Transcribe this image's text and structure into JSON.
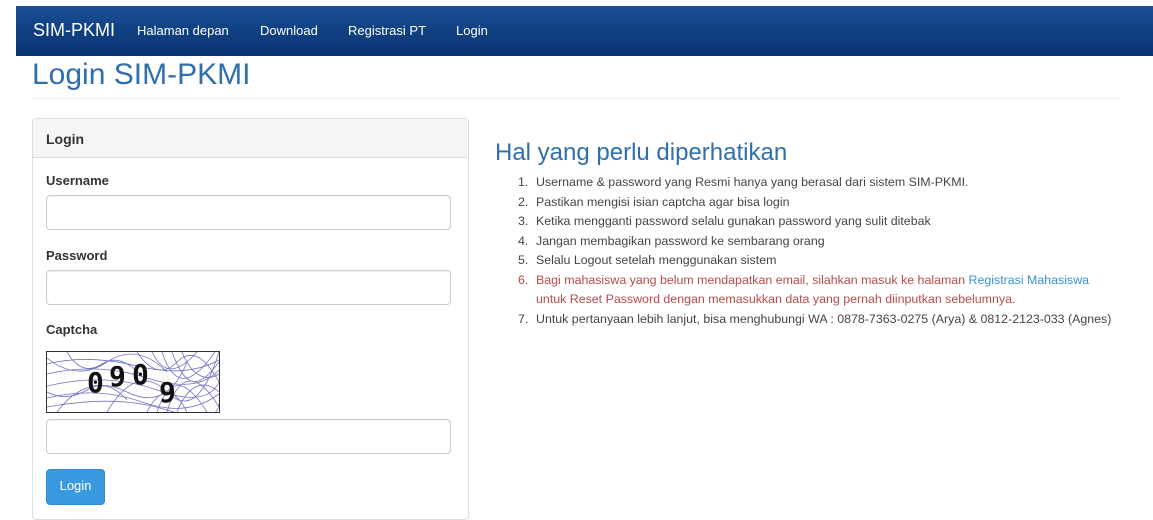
{
  "navbar": {
    "brand": "SIM-PKMI",
    "items": [
      {
        "label": "Halaman depan"
      },
      {
        "label": "Download"
      },
      {
        "label": "Registrasi PT"
      },
      {
        "label": "Login"
      }
    ]
  },
  "page": {
    "title": "Login SIM-PKMI"
  },
  "login_panel": {
    "heading": "Login",
    "username_label": "Username",
    "username_value": "",
    "password_label": "Password",
    "password_value": "",
    "captcha_label": "Captcha",
    "captcha_text": "0909",
    "captcha_value": "",
    "submit_label": "Login"
  },
  "info": {
    "title": "Hal yang perlu diperhatikan",
    "items": [
      {
        "num": "1.",
        "text": "Username & password yang Resmi hanya yang berasal dari sistem SIM-PKMI."
      },
      {
        "num": "2.",
        "text": "Pastikan mengisi isian captcha agar bisa login"
      },
      {
        "num": "3.",
        "text": "Ketika mengganti password selalu gunakan password yang sulit ditebak"
      },
      {
        "num": "4.",
        "text": "Jangan membagikan password ke sembarang orang"
      },
      {
        "num": "5.",
        "text": "Selalu Logout setelah menggunakan sistem"
      },
      {
        "num": "6.",
        "text_before": "Bagi mahasiswa yang belum mendapatkan email, silahkan masuk ke halaman ",
        "link": "Registrasi Mahasiswa",
        "text_after": " untuk Reset Password dengan memasukkan data yang pernah diinputkan sebelumnya."
      },
      {
        "num": "7.",
        "text": "Untuk pertanyaan lebih lanjut, bisa menghubungi WA : 0878-7363-0275 (Arya) & 0812-2123-033 (Agnes)"
      }
    ]
  },
  "colors": {
    "navbar": "#0f3f80",
    "title": "#2f6fad",
    "warning_text": "#b94a48",
    "link": "#3a8fd8",
    "button": "#3a9ae0"
  }
}
